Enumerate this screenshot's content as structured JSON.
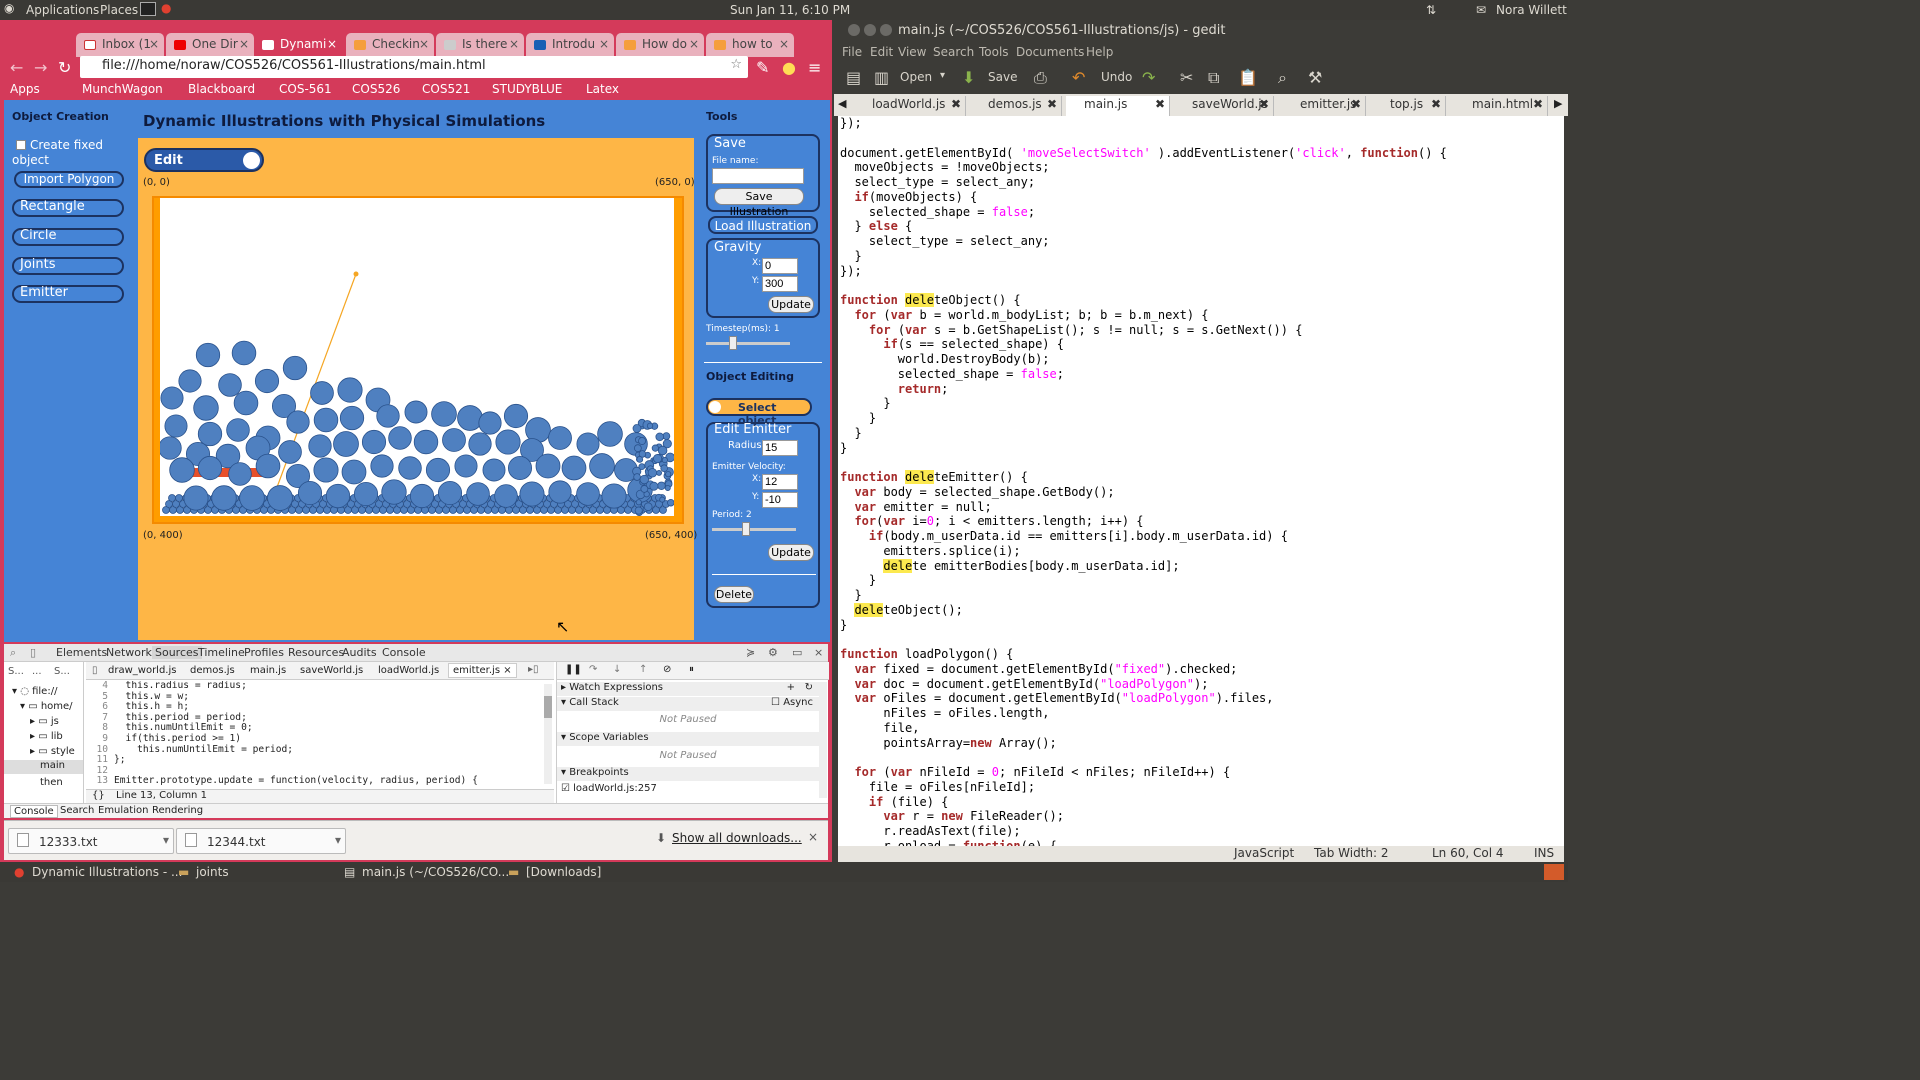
{
  "top_panel": {
    "applications": "Applications",
    "places": "Places",
    "clock": "Sun Jan 11,  6:10 PM",
    "user": "Nora Willett"
  },
  "browser": {
    "tabs": [
      {
        "label": "Inbox (1"
      },
      {
        "label": "One Dir"
      },
      {
        "label": "Dynami"
      },
      {
        "label": "Checkin"
      },
      {
        "label": "Is there"
      },
      {
        "label": "Introdu"
      },
      {
        "label": "How do"
      },
      {
        "label": "how to"
      }
    ],
    "url": "file:///home/noraw/COS526/COS561-Illustrations/main.html",
    "bookmarks": [
      "Apps",
      "MunchWagon",
      "Blackboard",
      "COS-561",
      "COS526",
      "COS521",
      "STUDYBLUE",
      "Latex"
    ]
  },
  "app": {
    "object_creation_title": "Object Creation",
    "create_fixed_label": "Create fixed object",
    "buttons": {
      "import": "Import Polygon",
      "rectangle": "Rectangle",
      "circle": "Circle",
      "joints": "Joints",
      "emitter": "Emitter"
    },
    "title": "Dynamic Illustrations with Physical Simulations",
    "edit_toggle": "Edit",
    "coords": {
      "tl": "(0, 0)",
      "tr": "(650, 0)",
      "bl": "(0, 400)",
      "br": "(650, 400)"
    },
    "tools_title": "Tools",
    "save": {
      "title": "Save",
      "file_name_label": "File name:",
      "file_name_value": "",
      "save_btn": "Save Illustration",
      "load_btn": "Load Illustration"
    },
    "gravity": {
      "title": "Gravity",
      "x_label": "X:",
      "x_value": "0",
      "y_label": "Y:",
      "y_value": "300",
      "update": "Update"
    },
    "timestep_label": "Timestep(ms): 1",
    "timestep_level": 0.3,
    "object_editing_title": "Object Editing",
    "select_object": "Select object",
    "edit_emitter": {
      "title": "Edit Emitter",
      "radius_label": "Radius:",
      "radius_value": "15",
      "velocity_label": "Emitter Velocity:",
      "x_label": "X:",
      "x_value": "12",
      "y_label": "Y:",
      "y_value": "-10",
      "period_label": "Period: 2",
      "period_level": 0.4,
      "update": "Update",
      "delete": "Delete"
    }
  },
  "devtools": {
    "tabs": [
      "Elements",
      "Network",
      "Sources",
      "Timeline",
      "Profiles",
      "Resources",
      "Audits",
      "Console"
    ],
    "file_tabs": [
      "draw_world.js",
      "demos.js",
      "main.js",
      "saveWorld.js",
      "loadWorld.js",
      "emitter.js"
    ],
    "tree": [
      "file://",
      "home/",
      "js",
      "lib",
      "style",
      "main",
      "then"
    ],
    "code_lines": [
      {
        "n": "4",
        "t": "  this.radius = radius;"
      },
      {
        "n": "5",
        "t": "  this.w = w;"
      },
      {
        "n": "6",
        "t": "  this.h = h;"
      },
      {
        "n": "7",
        "t": "  this.period = period;"
      },
      {
        "n": "8",
        "t": "  this.numUntilEmit = 0;"
      },
      {
        "n": "9",
        "t": "  if(this.period >= 1)"
      },
      {
        "n": "10",
        "t": "    this.numUntilEmit = period;"
      },
      {
        "n": "11",
        "t": "};"
      },
      {
        "n": "12",
        "t": ""
      },
      {
        "n": "13",
        "t": "Emitter.prototype.update = function(velocity, radius, period) {"
      }
    ],
    "cursor_pos": "Line 13, Column 1",
    "watch": "Watch Expressions",
    "call_stack": "Call Stack",
    "async": "Async",
    "not_paused": "Not Paused",
    "scope": "Scope Variables",
    "breakpoints": "Breakpoints",
    "breakpoint_item": "loadWorld.js:257",
    "drawer_tabs": [
      "Console",
      "Search",
      "Emulation",
      "Rendering"
    ]
  },
  "downloads": {
    "items": [
      "12333.txt",
      "12344.txt"
    ],
    "show_all": "Show all downloads..."
  },
  "gedit": {
    "title": "main.js (~/COS526/COS561-Illustrations/js) - gedit",
    "menu": [
      "File",
      "Edit",
      "View",
      "Search",
      "Tools",
      "Documents",
      "Help"
    ],
    "toolbar": {
      "open": "Open",
      "save": "Save",
      "undo": "Undo"
    },
    "tabs": [
      "loadWorld.js",
      "demos.js",
      "main.js",
      "saveWorld.js",
      "emitter.js",
      "top.js",
      "main.html"
    ],
    "status": {
      "lang": "JavaScript",
      "tab_width": "Tab Width: 2",
      "pos": "Ln 60, Col 4",
      "mode": "INS"
    }
  },
  "taskbar": [
    "Dynamic Illustrations - ...",
    "joints",
    "main.js (~/COS526/CO...",
    "[Downloads]"
  ]
}
